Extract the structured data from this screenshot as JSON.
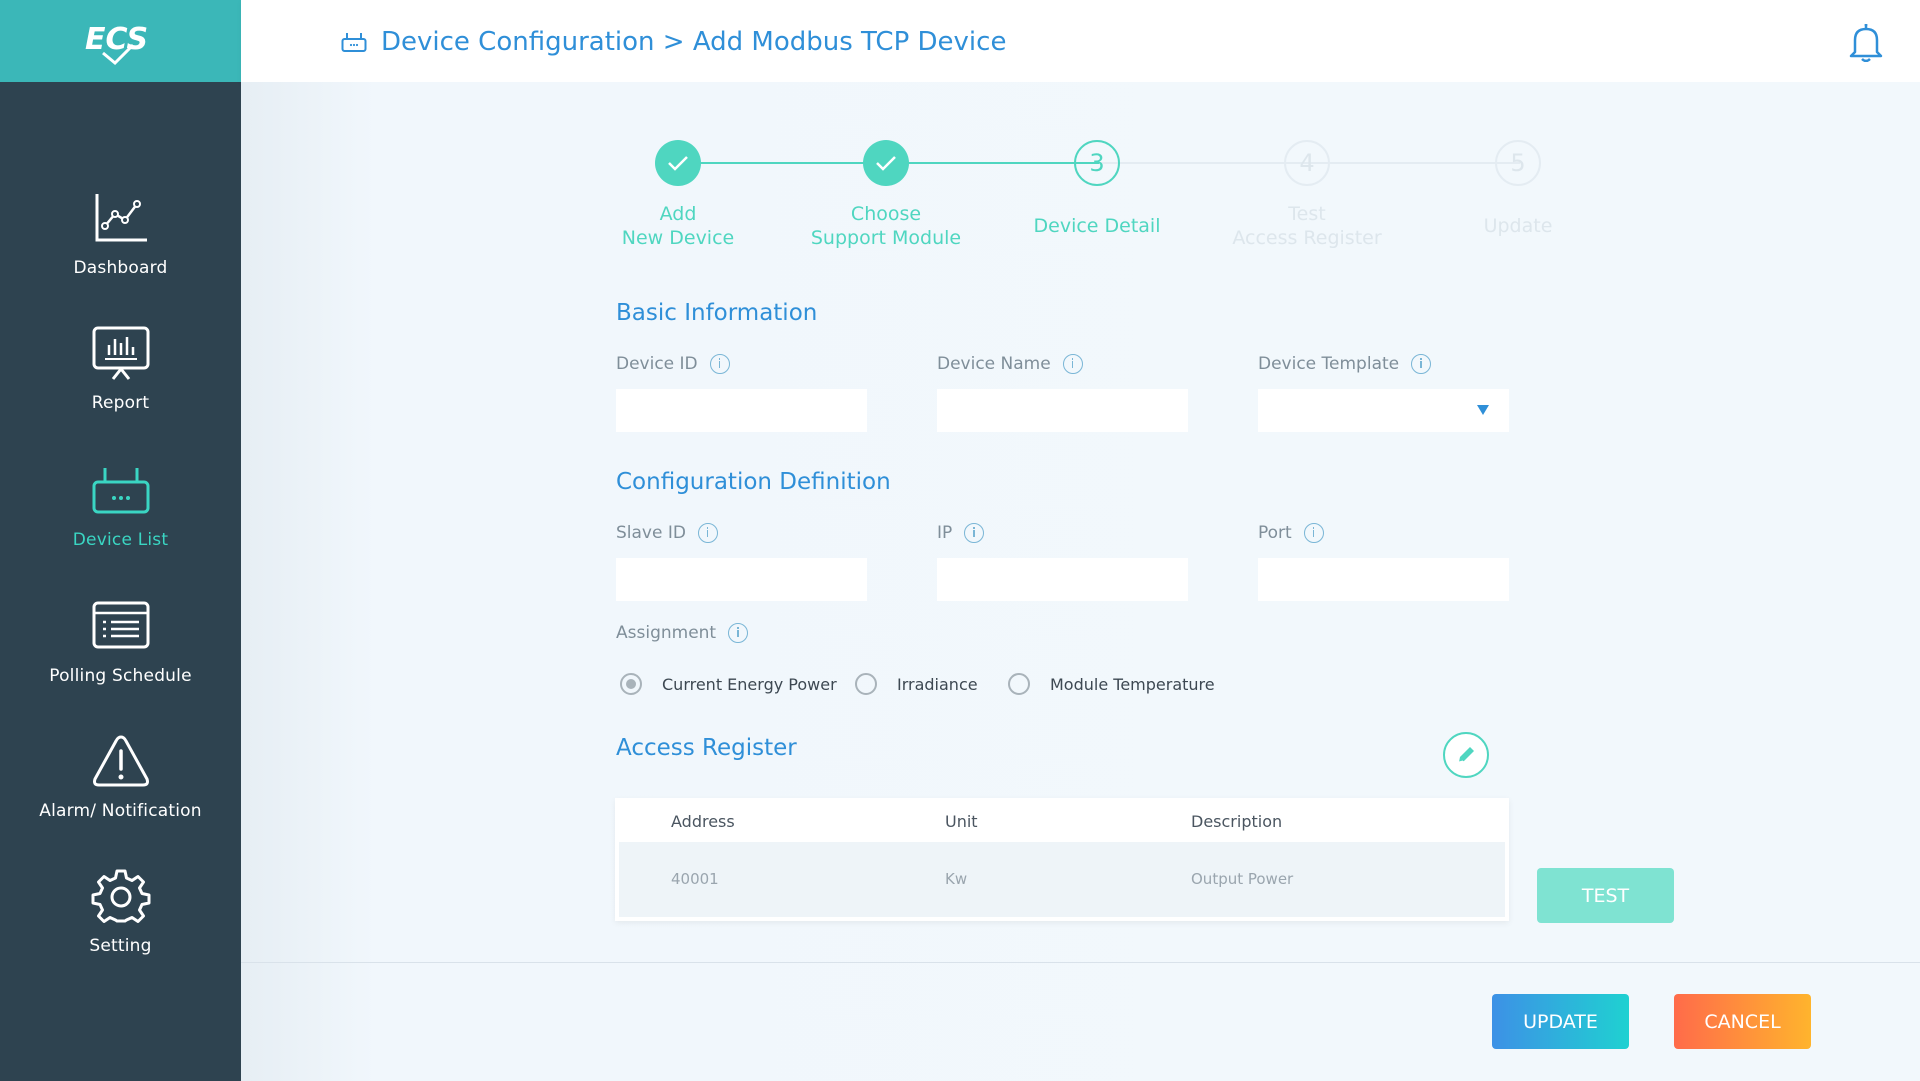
{
  "app": {
    "logo_text": "ECS"
  },
  "sidebar": {
    "items": [
      {
        "label": "Dashboard",
        "icon": "line-chart-icon",
        "active": false
      },
      {
        "label": "Report",
        "icon": "monitor-chart-icon",
        "active": false
      },
      {
        "label": "Device List",
        "icon": "router-icon",
        "active": true
      },
      {
        "label": "Polling Schedule",
        "icon": "list-icon",
        "active": false
      },
      {
        "label": "Alarm/ Notification",
        "icon": "warning-icon",
        "active": false
      },
      {
        "label": "Setting",
        "icon": "gear-icon",
        "active": false
      }
    ]
  },
  "header": {
    "title": "Device Configuration > Add Modbus TCP Device",
    "title_icon": "router-icon",
    "notification_icon": "bell-icon"
  },
  "stepper": {
    "steps": [
      {
        "label": "Add\nNew Device",
        "number": "",
        "status": "done"
      },
      {
        "label": "Choose\nSupport Module",
        "number": "",
        "status": "done"
      },
      {
        "label": "Device Detail",
        "number": "3",
        "status": "current"
      },
      {
        "label": "Test\nAccess Register",
        "number": "4",
        "status": "todo"
      },
      {
        "label": "Update",
        "number": "5",
        "status": "todo"
      }
    ]
  },
  "basic_info": {
    "title": "Basic Information",
    "device_id_label": "Device ID",
    "device_id_value": "",
    "device_name_label": "Device Name",
    "device_name_value": "",
    "device_template_label": "Device Template",
    "device_template_value": ""
  },
  "config": {
    "title": "Configuration Definition",
    "slave_id_label": "Slave ID",
    "slave_id_value": "",
    "ip_label": "IP",
    "ip_value": "",
    "port_label": "Port",
    "port_value": "",
    "assignment_label": "Assignment",
    "assignment_options": [
      {
        "label": "Current Energy Power",
        "checked": true
      },
      {
        "label": "Irradiance",
        "checked": false
      },
      {
        "label": "Module Temperature",
        "checked": false
      }
    ]
  },
  "access_register": {
    "title": "Access Register",
    "edit_icon": "pencil-icon",
    "columns": [
      "Address",
      "Unit",
      "Description"
    ],
    "rows": [
      [
        "40001",
        "Kw",
        "Output Power"
      ]
    ]
  },
  "buttons": {
    "test": "TEST",
    "update": "UPDATE",
    "cancel": "CANCEL"
  },
  "colors": {
    "sidebar_bg": "#2e4350",
    "logo_bg": "#3bb7b8",
    "accent_blue": "#2f8fd8",
    "accent_teal": "#4fd6c0"
  }
}
